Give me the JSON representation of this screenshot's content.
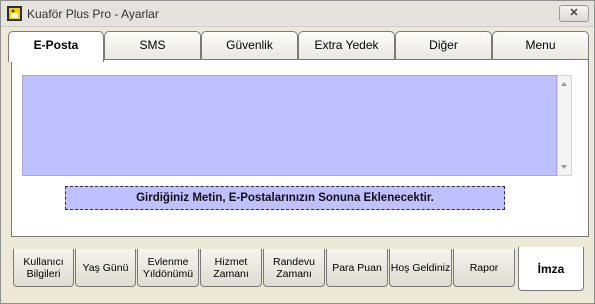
{
  "window": {
    "title": "Kuaför Plus Pro - Ayarlar",
    "close_label": "✕"
  },
  "top_tabs": [
    {
      "label": "E-Posta",
      "active": true
    },
    {
      "label": "SMS",
      "active": false
    },
    {
      "label": "Güvenlik",
      "active": false
    },
    {
      "label": "Extra Yedek",
      "active": false
    },
    {
      "label": "Diğer",
      "active": false
    },
    {
      "label": "Menu",
      "active": false
    }
  ],
  "email": {
    "editor_value": "",
    "note": "Girdiğiniz Metin, E-Postalarınızın Sonuna Eklenecektir."
  },
  "bottom_tabs": [
    {
      "label": "Kullanıcı Bilgileri",
      "active": false
    },
    {
      "label": "Yaş Günü",
      "active": false
    },
    {
      "label": "Evlenme Yıldönümü",
      "active": false
    },
    {
      "label": "Hizmet Zamanı",
      "active": false
    },
    {
      "label": "Randevu Zamanı",
      "active": false
    },
    {
      "label": "Para Puan",
      "active": false
    },
    {
      "label": "Hoş Geldiniz",
      "active": false
    },
    {
      "label": "Rapor",
      "active": false
    },
    {
      "label": "İmza",
      "active": true
    }
  ],
  "colors": {
    "editor_bg": "#c0c0ff",
    "window_bg": "#ece9d8"
  },
  "icons": {
    "app": "scissors-app-icon",
    "close": "close-icon"
  }
}
